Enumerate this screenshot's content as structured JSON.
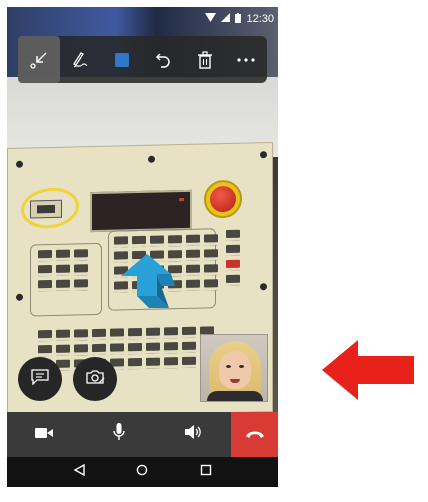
{
  "status_bar": {
    "time": "12:30",
    "icons": [
      "wifi-icon",
      "signal-icon",
      "battery-icon"
    ]
  },
  "toolbar": {
    "tools": [
      {
        "name": "collapse-icon",
        "active": true
      },
      {
        "name": "pen-icon",
        "active": false
      },
      {
        "name": "color-swatch",
        "active": false,
        "color": "#2f78c8"
      },
      {
        "name": "undo-icon",
        "active": false
      },
      {
        "name": "trash-icon",
        "active": false
      },
      {
        "name": "more-icon",
        "active": false
      }
    ]
  },
  "annotations": {
    "circle_color": "#f2d23a",
    "arrow_color": "#2aa0d8"
  },
  "floating_buttons": [
    "chat-icon",
    "snapshot-icon"
  ],
  "call_bar": {
    "buttons": [
      "video-camera-icon",
      "microphone-icon",
      "speaker-icon",
      "end-call-icon"
    ],
    "end_call_color": "#d83a34"
  },
  "nav_bar": {
    "buttons": [
      "back-icon",
      "home-icon",
      "recents-icon"
    ]
  },
  "pointer": {
    "color": "#e8211b"
  }
}
